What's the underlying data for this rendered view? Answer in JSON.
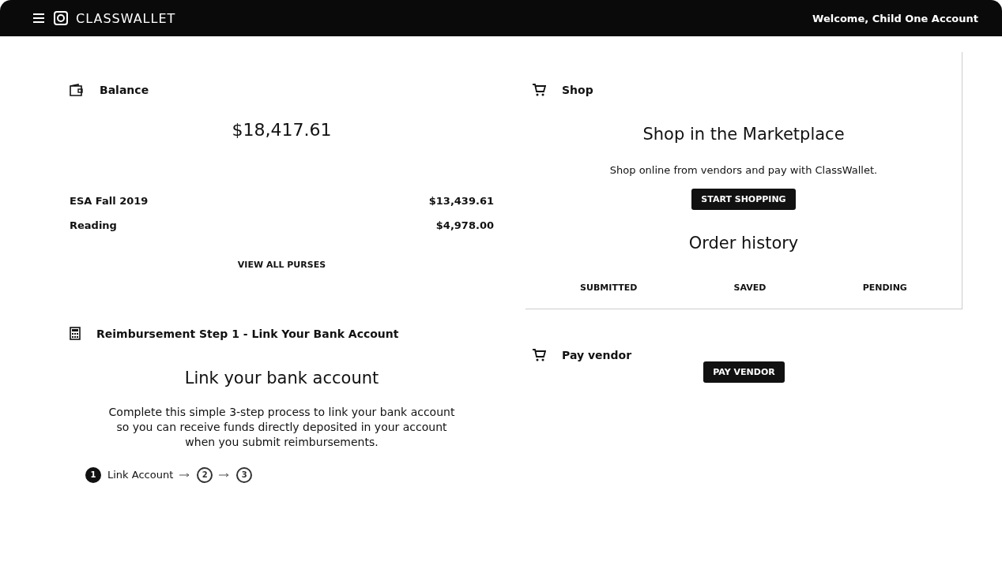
{
  "header": {
    "logo": "CLASSWALLET",
    "welcome": "Welcome, Child One Account"
  },
  "balance": {
    "title": "Balance",
    "total": "$18,417.61",
    "purses": [
      {
        "name": "ESA Fall 2019",
        "amount": "$13,439.61"
      },
      {
        "name": "Reading",
        "amount": "$4,978.00"
      }
    ],
    "link": "VIEW ALL PURSES"
  },
  "shop": {
    "title": "Shop",
    "heading": "Shop in the Marketplace",
    "text": "Shop online from vendors and pay with ClassWallet.",
    "button": "START SHOPPING",
    "history_title": "Order history",
    "history_tabs": [
      "SUBMITTED",
      "SAVED",
      "PENDING"
    ]
  },
  "reimbursement": {
    "title": "Reimbursement Step 1 - Link Your Bank Account",
    "heading": "Link your bank account",
    "text": "Complete this simple 3-step process to link your bank account so you can receive funds directly deposited in your account when you submit reimbursements.",
    "steps": [
      {
        "number": "1",
        "label": "Link Account",
        "active": true
      },
      {
        "number": "2",
        "active": false
      },
      {
        "number": "3",
        "active": false
      }
    ]
  },
  "pay_vendor": {
    "title": "Pay vendor",
    "button": "PAY VENDOR"
  }
}
